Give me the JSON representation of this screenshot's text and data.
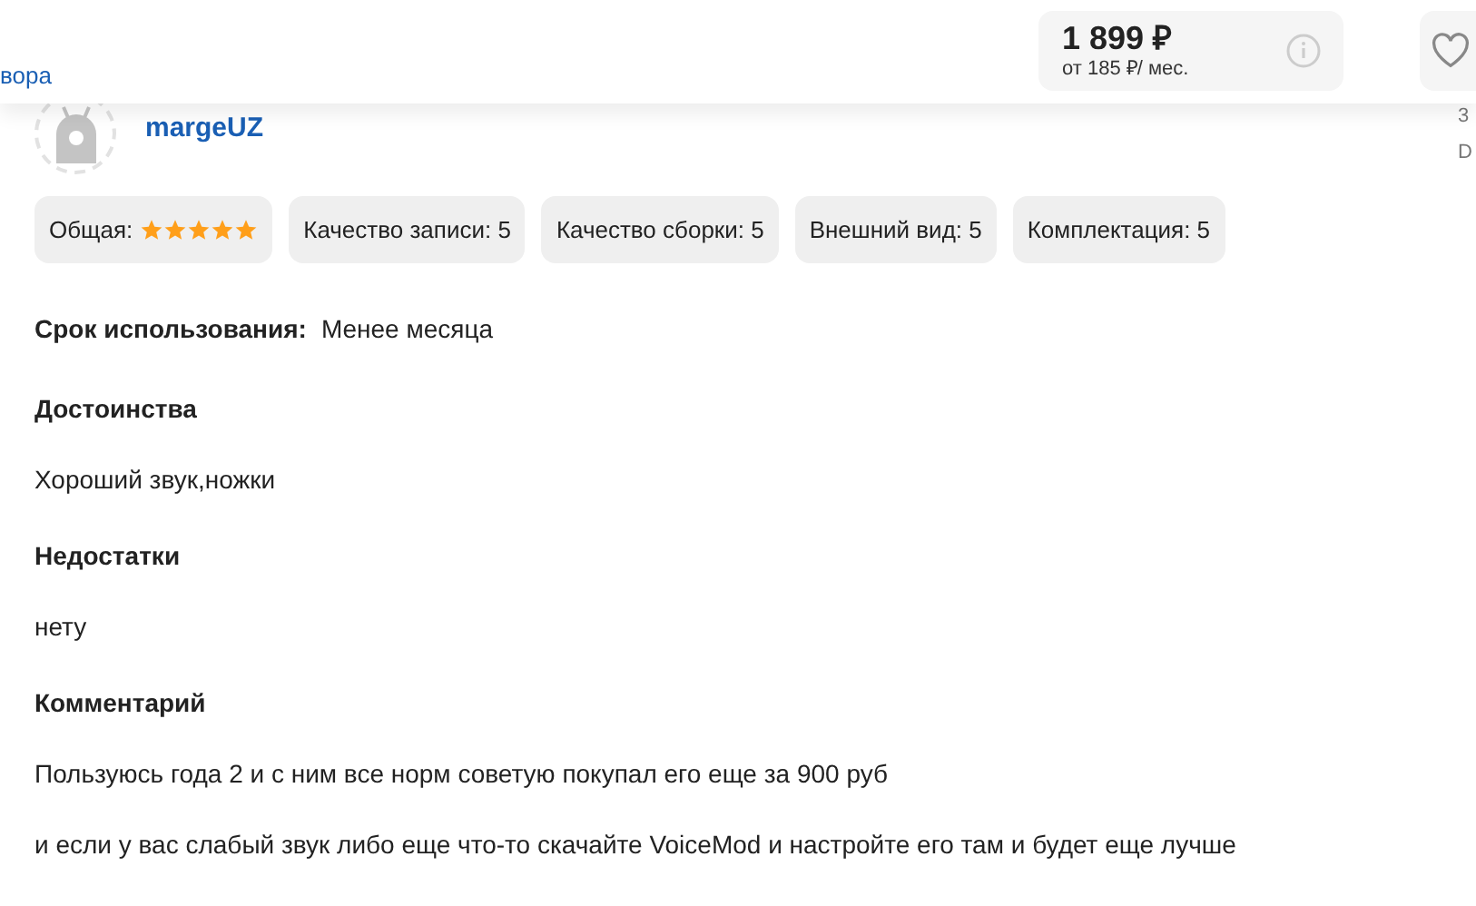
{
  "top_bar": {
    "link": "вора",
    "price": "1 899 ₽",
    "installment": "от 185 ₽/ мес."
  },
  "review": {
    "author": "margeUZ",
    "side_texts": [
      "3",
      "D"
    ],
    "ratings": [
      {
        "kind": "stars",
        "label": "Общая:",
        "stars": 5
      },
      {
        "kind": "text",
        "label": "Качество записи: 5"
      },
      {
        "kind": "text",
        "label": "Качество сборки: 5"
      },
      {
        "kind": "text",
        "label": "Внешний вид: 5"
      },
      {
        "kind": "text",
        "label": "Комплектация: 5"
      }
    ],
    "usage": {
      "label": "Срок использования:",
      "value": "Менее месяца"
    },
    "sections": [
      {
        "title": "Достоинства",
        "paragraphs": [
          "Хороший звук,ножки"
        ]
      },
      {
        "title": "Недостатки",
        "paragraphs": [
          "нету"
        ]
      },
      {
        "title": "Комментарий",
        "paragraphs": [
          "Пользуюсь года 2 и с ним все норм советую покупал его еще за 900 руб",
          "и если у вас слабый звук либо еще что-то скачайте VoiceMod и настройте его там и будет еще лучше"
        ]
      }
    ]
  }
}
